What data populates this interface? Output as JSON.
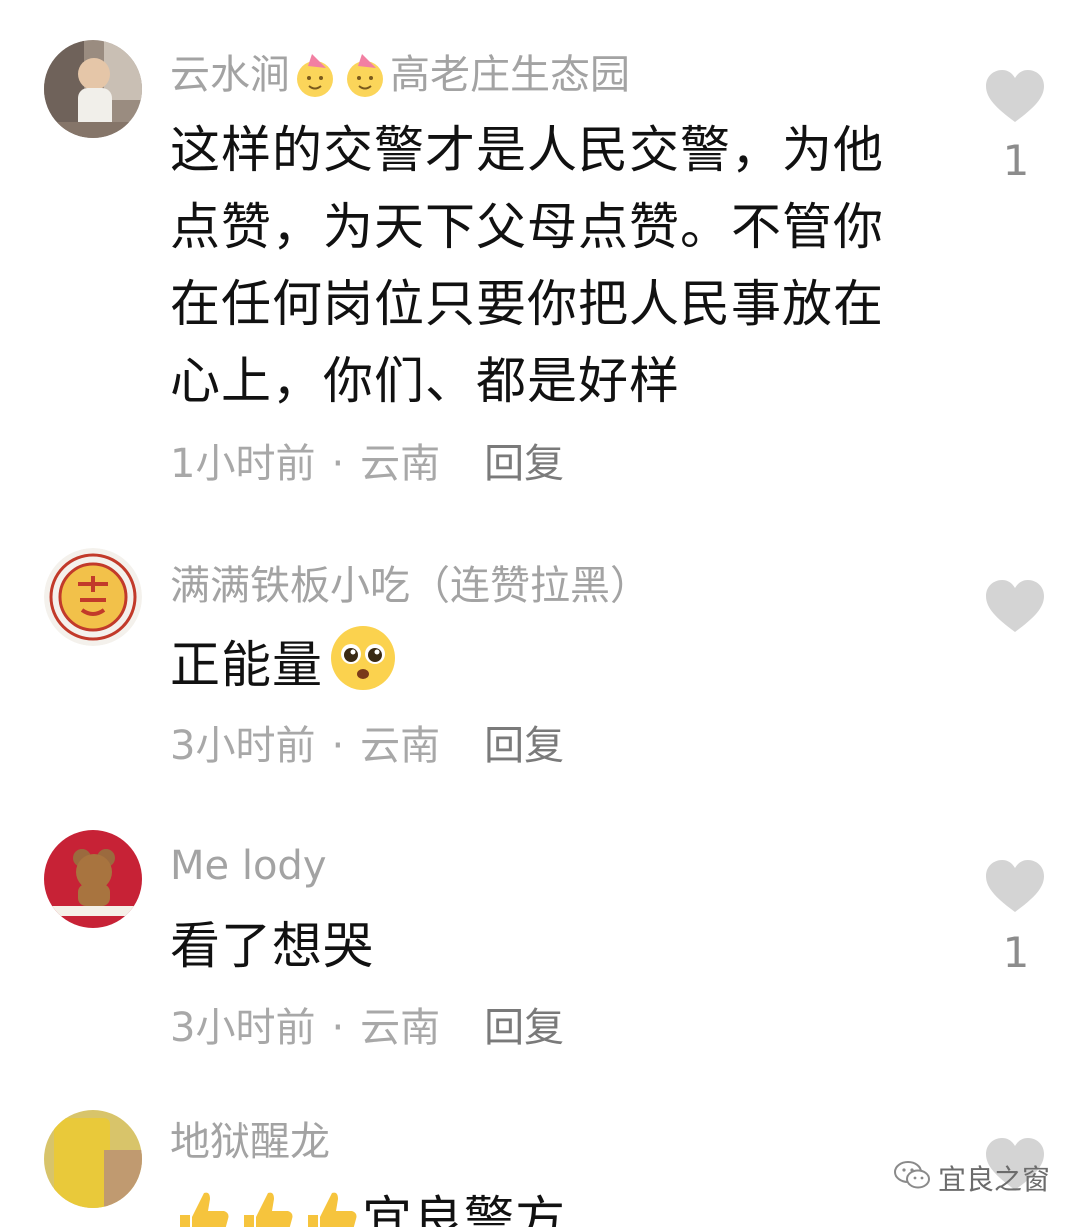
{
  "comments": [
    {
      "username_part1": "云水涧",
      "username_part2": "高老庄生态园",
      "text": "这样的交警才是人民交警，为他点赞，为天下父母点赞。不管你在任何岗位只要你把人民事放在心上，你们、都是好样",
      "time": "1小时前",
      "location": "云南",
      "reply": "回复",
      "likes": "1"
    },
    {
      "username": "满满铁板小吃（连赞拉黑）",
      "text": "正能量",
      "time": "3小时前",
      "location": "云南",
      "reply": "回复"
    },
    {
      "username": "Me lody",
      "text": "看了想哭",
      "time": "3小时前",
      "location": "云南",
      "reply": "回复",
      "likes": "1"
    },
    {
      "username": "地狱醒龙",
      "text_partial": "宜良警方"
    }
  ],
  "separator": "·",
  "watermark": "宜良之窗",
  "icons": {
    "like": "heart-icon",
    "emoji_party": "party-face-emoji",
    "emoji_pleading": "pleading-face-emoji",
    "emoji_thumbs": "thumbs-up-emoji",
    "watermark": "wechat-icon"
  },
  "colors": {
    "username": "#a3a3a3",
    "content": "#111111",
    "meta": "#a8a8a8",
    "heart": "#d4d4d4"
  }
}
